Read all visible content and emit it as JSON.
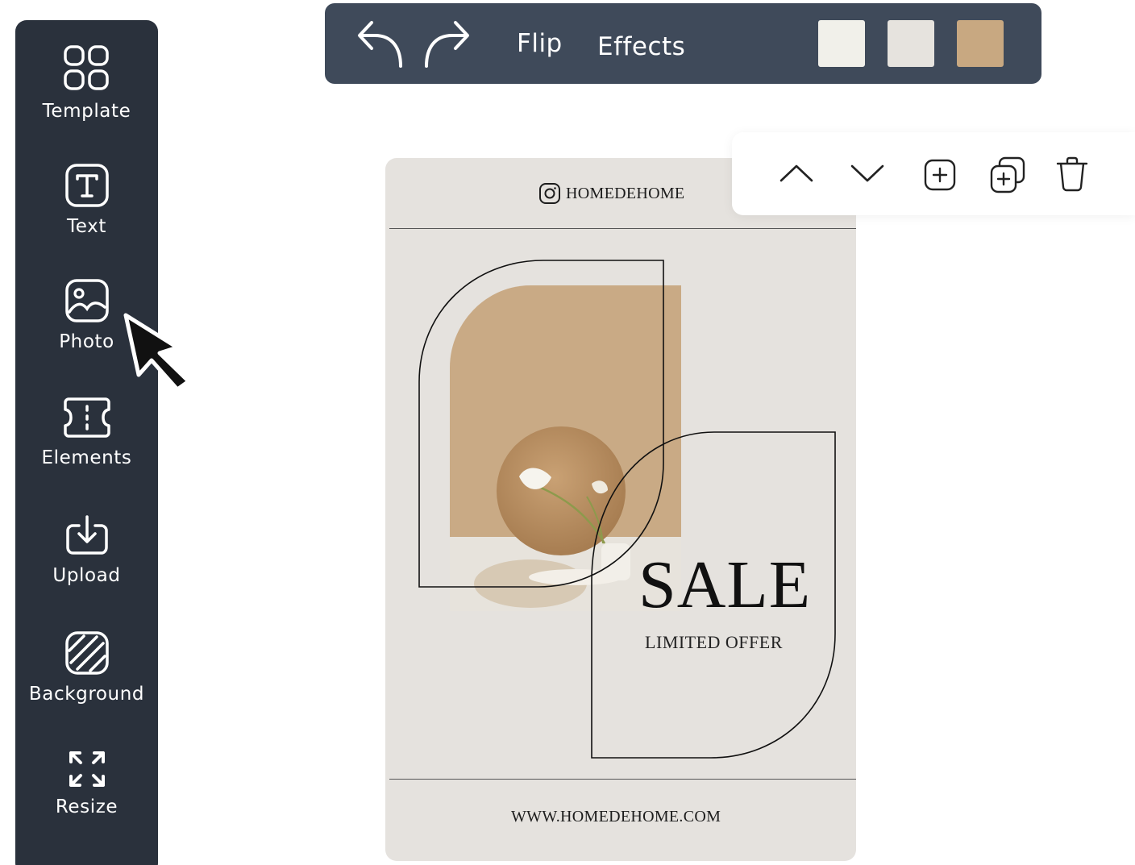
{
  "sidebar": {
    "items": [
      {
        "label": "Template",
        "icon": "grid-icon"
      },
      {
        "label": "Text",
        "icon": "text-icon"
      },
      {
        "label": "Photo",
        "icon": "photo-icon"
      },
      {
        "label": "Elements",
        "icon": "elements-icon"
      },
      {
        "label": "Upload",
        "icon": "upload-icon"
      },
      {
        "label": "Background",
        "icon": "background-icon"
      },
      {
        "label": "Resize",
        "icon": "resize-icon"
      }
    ]
  },
  "toolbar": {
    "undo_icon": "undo-icon",
    "redo_icon": "redo-icon",
    "flip_label": "Flip",
    "effects_label": "Effects",
    "swatches": [
      "#f1f0ea",
      "#e6e3de",
      "#c8a881"
    ]
  },
  "layer_toolbar": {
    "icons": [
      "chevron-up-icon",
      "chevron-down-icon",
      "add-icon",
      "duplicate-icon",
      "trash-icon"
    ]
  },
  "design": {
    "brand": "HOMEDEHOME",
    "headline": "SALE",
    "subheadline": "LIMITED OFFER",
    "website": "WWW.HOMEDEHOME.COM",
    "colors": {
      "background": "#e5e2de",
      "accent": "#c8a881"
    }
  }
}
